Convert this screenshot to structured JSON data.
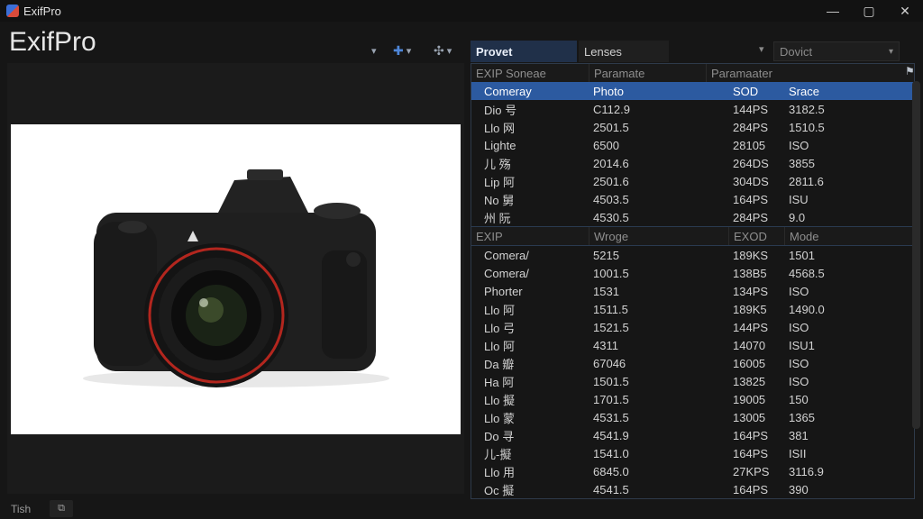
{
  "window": {
    "title": "ExifPro",
    "minimize": "—",
    "maximize": "▢",
    "close": "✕"
  },
  "app_title": "ExifPro",
  "toolbar": {
    "arrow": "▾"
  },
  "tabs": [
    {
      "label": "Provet",
      "active": true
    },
    {
      "label": "Lenses",
      "active": false
    }
  ],
  "right_select": {
    "value": "Dovict",
    "arrow": "▾"
  },
  "table": {
    "section1_header": [
      "EXIP Soneae",
      "Paramate",
      "Paramaater"
    ],
    "section1_rows": [
      [
        "Comeray",
        "Photo",
        "SOD",
        "Srace"
      ],
      [
        "Dio 号",
        "C112.9",
        "144PS",
        "3182.5"
      ],
      [
        "Llo 网",
        "2501.5",
        "284PS",
        "1510.5"
      ],
      [
        "Lighte",
        "6500",
        "28105",
        "ISO"
      ],
      [
        "儿 殇",
        "2014.6",
        "264DS",
        "3855"
      ],
      [
        "Lip 阿",
        "2501.6",
        "304DS",
        "2811.6"
      ],
      [
        "No 舅",
        "4503.5",
        "164PS",
        "ISU"
      ],
      [
        "州 阮",
        "4530.5",
        "284PS",
        "9.0"
      ]
    ],
    "section2_header": [
      "EXIP",
      "Wroge",
      "EXOD",
      "Mode"
    ],
    "section2_rows": [
      [
        "Comera/",
        "5215",
        "189KS",
        "1501"
      ],
      [
        "Comera/",
        "1001.5",
        "138B5",
        "4568.5"
      ],
      [
        "Phorter",
        "1531",
        "134PS",
        "ISO"
      ],
      [
        "Llo 阿",
        "1511.5",
        "189K5",
        "1490.0"
      ],
      [
        "Llo 弓",
        "1521.5",
        "144PS",
        "ISO"
      ],
      [
        "Llo 阿",
        "4311",
        "14070",
        "ISU1"
      ],
      [
        "Da 瓣",
        "67046",
        "16005",
        "ISO"
      ],
      [
        "Ha 阿",
        "1501.5",
        "13825",
        "ISO"
      ],
      [
        "Llo 擬",
        "1701.5",
        "19005",
        "150"
      ],
      [
        "Llo 蒙",
        "4531.5",
        "13005",
        "1365"
      ],
      [
        "Do 寻",
        "4541.9",
        "164PS",
        "381"
      ],
      [
        "儿-擬",
        "1541.0",
        "164PS",
        "ISII"
      ],
      [
        "Llo 用",
        "6845.0",
        "27KPS",
        "3116.9"
      ],
      [
        "Oc 擬",
        "4541.5",
        "164PS",
        "390"
      ]
    ]
  },
  "status": {
    "text": "Tish"
  },
  "icons": {
    "app": "exifpro-logo-icon",
    "pin": "pin-icon",
    "move": "move-icon",
    "filter": "filter-icon",
    "status": "frame-icon"
  },
  "colors": {
    "selection": "#2c5aa0",
    "active_tab": "#203049",
    "accent": "#4e86d8"
  }
}
